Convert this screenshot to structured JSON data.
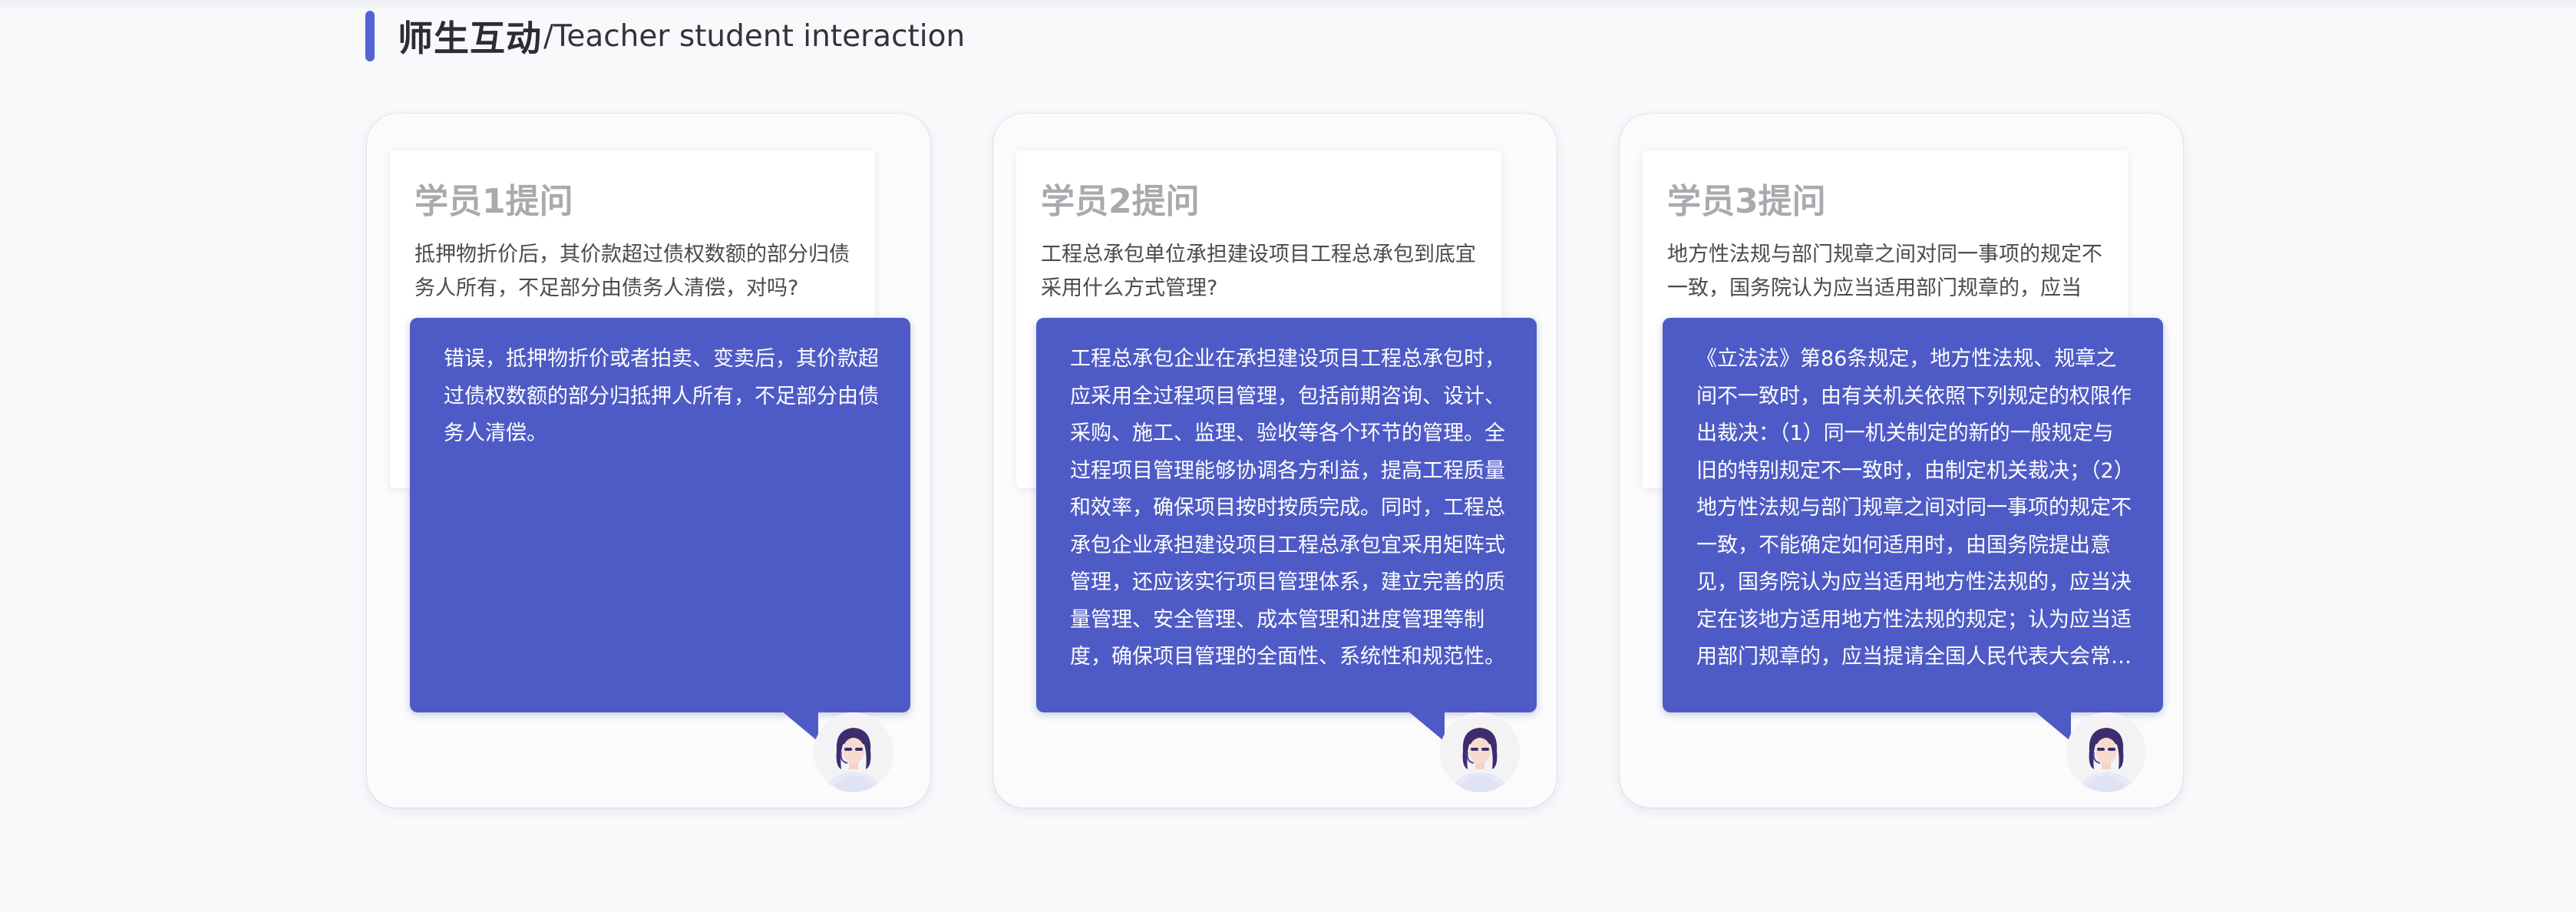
{
  "header": {
    "title": "师生互动",
    "subtitle": "/Teacher student interaction",
    "accent_color": "#5663d4"
  },
  "cards": [
    {
      "question_title": "学员1提问",
      "question_text": "抵押物折价后，其价款超过债权数额的部分归债务人所有，不足部分由债务人清偿，对吗?",
      "answer_text": "错误，抵押物折价或者拍卖、变卖后，其价款超过债权数额的部分归抵押人所有，不足部分由债务人清偿。",
      "avatar_icon": "teacher-avatar-icon"
    },
    {
      "question_title": "学员2提问",
      "question_text": "工程总承包单位承担建设项目工程总承包到底宜采用什么方式管理?",
      "answer_text": "工程总承包企业在承担建设项目工程总承包时，应采用全过程项目管理，包括前期咨询、设计、采购、施工、监理、验收等各个环节的管理。全过程项目管理能够协调各方利益，提高工程质量和效率，确保项目按时按质完成。同时，工程总承包企业承担建设项目工程总承包宜采用矩阵式管理，还应该实行项目管理体系，建立完善的质量管理、安全管理、成本管理和进度管理等制度，确保项目管理的全面性、系统性和规范性。",
      "avatar_icon": "teacher-avatar-icon"
    },
    {
      "question_title": "学员3提问",
      "question_text": "地方性法规与部门规章之间对同一事项的规定不一致，国务院认为应当适用部门规章的，应当由?",
      "answer_text": "《立法法》第86条规定，地方性法规、规章之间不一致时，由有关机关依照下列规定的权限作出裁决：（1）同一机关制定的新的一般规定与旧的特别规定不一致时，由制定机关裁决；（2）地方性法规与部门规章之间对同一事项的规定不一致，不能确定如何适用时，由国务院提出意见，国务院认为应当适用地方性法规的，应当决定在该地方适用地方性法规的规定；认为应当适用部门规章的，应当提请全国人民代表大会常务委员会裁决。",
      "avatar_icon": "teacher-avatar-icon"
    }
  ],
  "colors": {
    "answer_bg": "#4e5bc6",
    "question_title": "#a9a9ae"
  }
}
